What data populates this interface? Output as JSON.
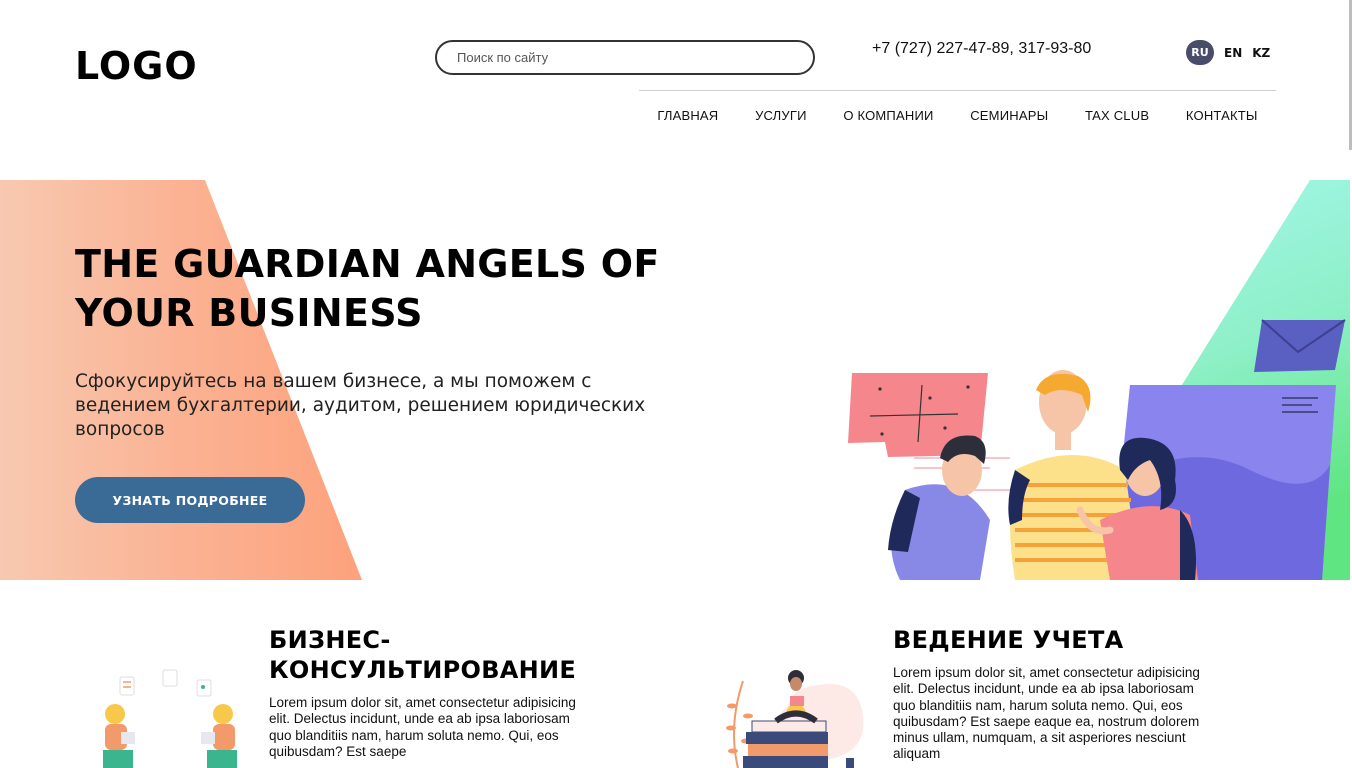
{
  "header": {
    "logo": "LOGO",
    "search_placeholder": "Поиск по сайту",
    "phone": "+7 (727) 227-47-89, 317-93-80",
    "languages": [
      "RU",
      "EN",
      "KZ"
    ],
    "active_language": "RU"
  },
  "nav": {
    "items": [
      "ГЛАВНАЯ",
      "УСЛУГИ",
      "О КОМПАНИИ",
      "СЕМИНАРЫ",
      "TAX CLUB",
      "КОНТАКТЫ"
    ]
  },
  "hero": {
    "title": "THE GUARDIAN ANGELS OF YOUR BUSINESS",
    "subtitle": "Сфокусируйтесь на вашем бизнесе, а мы поможем с ведением бухгалтерии, аудитом, решением юридических вопросов",
    "button_label": "УЗНАТЬ ПОДРОБНЕЕ"
  },
  "services": [
    {
      "title": "БИЗНЕС-КОНСУЛЬТИРОВАНИЕ",
      "text": "Lorem ipsum dolor sit, amet consectetur adipisicing elit. Delectus incidunt, unde ea ab ipsa laboriosam quo blanditiis nam, harum soluta nemo. Qui, eos quibusdam? Est saepe"
    },
    {
      "title": "ВЕДЕНИЕ УЧЕТА",
      "text": "Lorem ipsum dolor sit, amet consectetur adipisicing elit. Delectus incidunt, unde ea ab ipsa laboriosam quo blanditiis nam, harum soluta nemo. Qui, eos quibusdam? Est saepe eaque ea, nostrum dolorem minus ullam, numquam, a sit asperiores nesciunt aliquam"
    }
  ],
  "colors": {
    "button": "#3a6b97",
    "active_lang": "#4a4d6a",
    "hero_orange": "#fcaa82",
    "hero_teal": "#7ef0d8",
    "hero_green": "#6fe08a"
  }
}
